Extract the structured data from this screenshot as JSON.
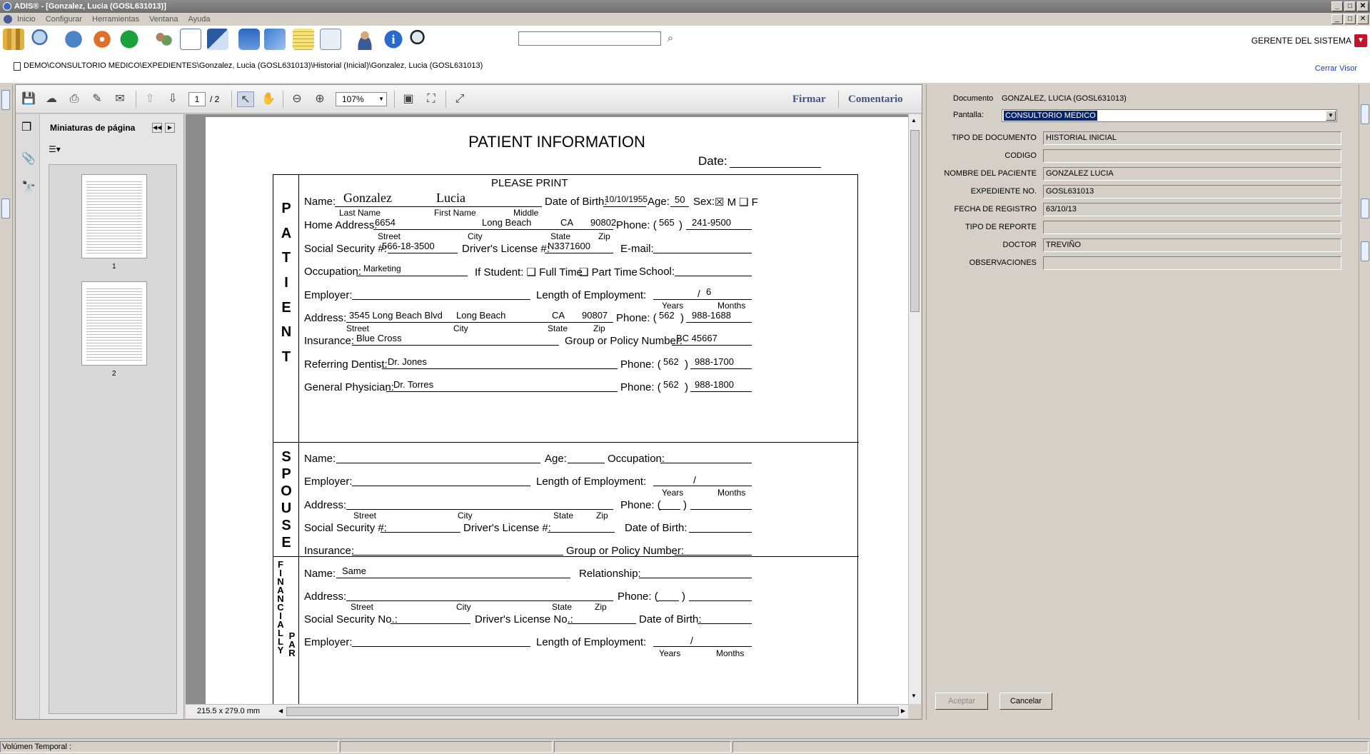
{
  "window": {
    "title": "ADIS® - [Gonzalez, Lucia (GOSL631013)]",
    "controls": [
      "_",
      "□",
      "✕"
    ]
  },
  "menu": [
    "Inicio",
    "Configurar",
    "Herramientas",
    "Ventana",
    "Ayuda"
  ],
  "toolbar": {
    "search_value": "",
    "user": "GERENTE DEL SISTEMA",
    "icons": [
      "library-icon",
      "search-icon",
      "globe-icon",
      "disc-icon",
      "play-icon",
      "people-icon",
      "patient-card-icon",
      "chart-icon",
      "book-icon",
      "map-icon",
      "notes-icon",
      "window-icon",
      "user-icon",
      "info-icon",
      "zoom-icon"
    ]
  },
  "path": {
    "text": "DEMO\\CONSULTORIO MEDICO\\EXPEDIENTES\\Gonzalez, Lucia (GOSL631013)\\Historial (Inicial)\\Gonzalez, Lucia (GOSL631013)",
    "close_label": "Cerrar Visor"
  },
  "viewer": {
    "page_current": "1",
    "page_total": "/ 2",
    "zoom": "107%",
    "sign_label": "Firmar",
    "comment_label": "Comentario",
    "thumbs_title": "Miniaturas de página",
    "thumb_pages": [
      "1",
      "2"
    ],
    "page_size": "215.5 x 279.0 mm"
  },
  "form": {
    "title": "PATIENT INFORMATION",
    "date_label": "Date:",
    "please_print": "PLEASE PRINT",
    "patient_letters": [
      "P",
      "A",
      "T",
      "I",
      "E",
      "N",
      "T"
    ],
    "spouse_letters": [
      "S",
      "P",
      "O",
      "U",
      "S",
      "E"
    ],
    "fin_letters": [
      "F",
      "I",
      "N",
      "A",
      "N",
      "C",
      "I",
      "A",
      "L",
      "L",
      "Y"
    ],
    "fin_letters2": [
      "P",
      "A",
      "R"
    ],
    "patient": {
      "name_label": "Name:",
      "last_name": "Gonzalez",
      "first_name": "Lucia",
      "last_name_label": "Last Name",
      "first_name_label": "First Name",
      "middle_label": "Middle",
      "dob_label": "Date of Birth:",
      "dob": "10/10/1955",
      "age_label": "Age:",
      "age": "50",
      "sex_label": "Sex:",
      "sex_m": "☒ M",
      "sex_f": "❑ F",
      "home_address_label": "Home Address:",
      "home_street": "6654",
      "home_city": "Long Beach",
      "home_state": "CA",
      "home_zip": "90802",
      "street_label": "Street",
      "city_label": "City",
      "state_label": "State",
      "zip_label": "Zip",
      "phone_label": "Phone: (",
      "phone_close": ")",
      "home_area": "565",
      "home_phone": "241-9500",
      "ssn_label": "Social Security #:",
      "ssn": "566-18-3500",
      "dl_label": "Driver's License #:",
      "dl": "N3371600",
      "email_label": "E-mail:",
      "occupation_label": "Occupation:",
      "occupation": "Marketing",
      "student_label": "If Student: ❑ Full Time",
      "part_time_label": "❑ Part Time",
      "school_label": "School:",
      "employer_label": "Employer:",
      "length_label": "Length of Employment:",
      "length_slash": "/",
      "length_months": "6",
      "years_label": "Years",
      "months_label": "Months",
      "address_label": "Address:",
      "emp_street": "3545 Long Beach Blvd",
      "emp_city": "Long Beach",
      "emp_state": "CA",
      "emp_zip": "90807",
      "emp_area": "562",
      "emp_phone": "988-1688",
      "insurance_label": "Insurance:",
      "insurance": "Blue Cross",
      "group_label": "Group or Policy Number:",
      "group": "BC 45667",
      "ref_dentist_label": "Referring Dentist:",
      "ref_dentist": "Dr. Jones",
      "ref_area": "562",
      "ref_phone": "988-1700",
      "gp_label": "General Physician:",
      "gp": "Dr. Torres",
      "gp_area": "562",
      "gp_phone": "988-1800"
    },
    "spouse": {
      "name_label": "Name:",
      "age_label": "Age:",
      "occupation_label": "Occupation:",
      "employer_label": "Employer:",
      "length_label": "Length of Employment:",
      "slash": "/",
      "years_label": "Years",
      "months_label": "Months",
      "address_label": "Address:",
      "street_label": "Street",
      "city_label": "City",
      "state_label": "State",
      "zip_label": "Zip",
      "phone_label": "Phone: (",
      "phone_close": ")",
      "ssn_label": "Social Security #:",
      "dl_label": "Driver's License #:",
      "dob_label": "Date of Birth:",
      "insurance_label": "Insurance:",
      "group_label": "Group or Policy Number:"
    },
    "financial": {
      "name_label": "Name:",
      "name": "Same",
      "relationship_label": "Relationship:",
      "address_label": "Address:",
      "street_label": "Street",
      "city_label": "City",
      "state_label": "State",
      "zip_label": "Zip",
      "phone_label": "Phone: (",
      "phone_close": ")",
      "ssn_label": "Social Security No.:",
      "dl_label": "Driver's License No.:",
      "dob_label": "Date of Birth:",
      "employer_label": "Employer:",
      "length_label": "Length of Employment:",
      "slash": "/",
      "years_label": "Years",
      "months_label": "Months"
    }
  },
  "right_panel": {
    "document_label": "Documento",
    "document_value": "GONZALEZ, LUCIA (GOSL631013)",
    "pantalla_label": "Pantalla:",
    "pantalla_value": "CONSULTORIO MEDICO",
    "fields": [
      {
        "label": "TIPO DE DOCUMENTO",
        "value": "HISTORIAL INICIAL"
      },
      {
        "label": "CODIGO",
        "value": ""
      },
      {
        "label": "NOMBRE DEL PACIENTE",
        "value": "GONZALEZ LUCIA"
      },
      {
        "label": "EXPEDIENTE NO.",
        "value": "GOSL631013"
      },
      {
        "label": "FECHA DE REGISTRO",
        "value": "63/10/13"
      },
      {
        "label": "TIPO DE REPORTE",
        "value": ""
      },
      {
        "label": "DOCTOR",
        "value": "TREVIÑO"
      },
      {
        "label": "OBSERVACIONES",
        "value": ""
      }
    ],
    "accept_label": "Aceptar",
    "cancel_label": "Cancelar"
  },
  "status": {
    "volume_label": "Volúmen Temporal :"
  },
  "colors": {
    "accent": "#0a246a",
    "link": "#1a3ea8",
    "sign_text": "#46557a",
    "user_drop": "#c0152b"
  }
}
